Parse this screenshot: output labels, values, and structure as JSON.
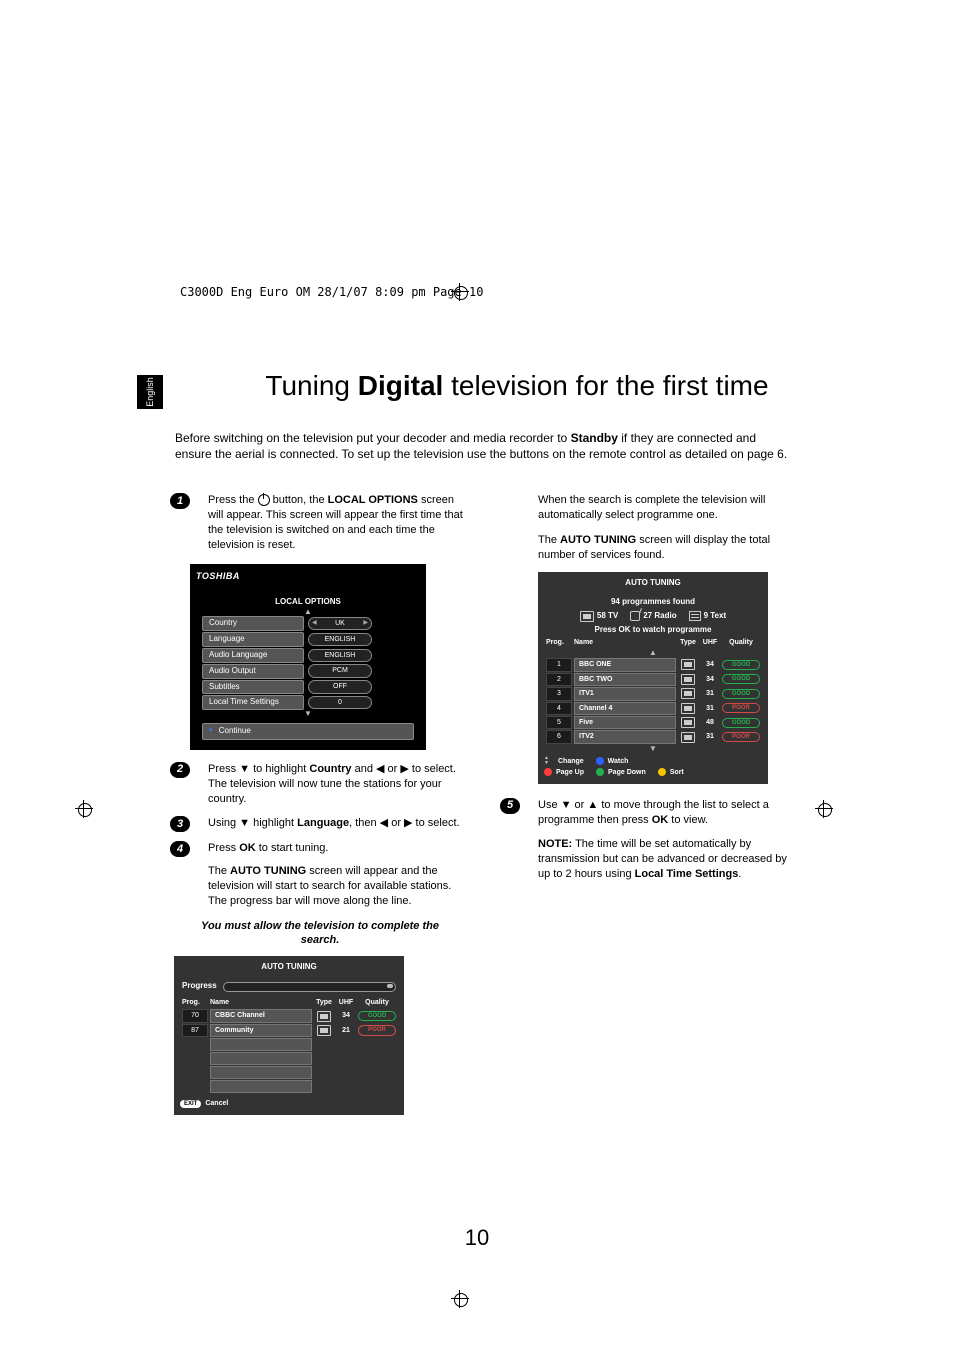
{
  "header_note": "C3000D Eng Euro OM  28/1/07  8:09 pm  Page 10",
  "sidetab": "English",
  "title_pre": "Tuning ",
  "title_bold": "Digital",
  "title_post": " television for the first time",
  "intro_a": "Before switching on the television put your decoder and media recorder to ",
  "intro_b": "Standby",
  "intro_c": " if they are connected and ensure the aerial is connected. To set up the television use the buttons on the remote control as detailed on page 6.",
  "steps": {
    "s1": {
      "num": "1",
      "pre": "Press the ",
      "mid": " button, the ",
      "b1": "LOCAL OPTIONS",
      "post": " screen will appear. This screen will appear the first time that the television is switched on and each time the television is reset."
    },
    "s2": {
      "num": "2",
      "a": "Press ▼ to highlight ",
      "b1": "Country",
      "b": " and ◀ or ▶ to select. The television will now tune the stations for your country."
    },
    "s3": {
      "num": "3",
      "a": "Using ▼ highlight ",
      "b1": "Language",
      "b": ", then ◀ or ▶ to select."
    },
    "s4": {
      "num": "4",
      "a": "Press ",
      "b1": "OK",
      "b": " to start tuning.",
      "para_a": "The ",
      "para_b": "AUTO TUNING",
      "para_c": " screen will appear and the television will start to search for available stations. The progress bar will move along the line.",
      "emph": "You must allow the television to complete the search."
    },
    "sR1": "When the search is complete the television will automatically select programme one.",
    "sR2_a": "The ",
    "sR2_b": "AUTO TUNING",
    "sR2_c": " screen will display the total number of services found.",
    "s5": {
      "num": "5",
      "a": "Use ▼ or ▲ to move through the list to select a programme then press ",
      "b1": "OK",
      "b": " to view."
    },
    "note_a": "NOTE:",
    "note_b": " The time will be set automatically by transmission but can be advanced or decreased by up to 2 hours using ",
    "note_c": "Local Time Settings",
    "note_d": "."
  },
  "local_options": {
    "brand": "TOSHIBA",
    "title": "LOCAL OPTIONS",
    "rows": [
      {
        "label": "Country",
        "value": "UK",
        "pill": true
      },
      {
        "label": "Language",
        "value": "ENGLISH"
      },
      {
        "label": "Audio Language",
        "value": "ENGLISH"
      },
      {
        "label": "Audio Output",
        "value": "PCM"
      },
      {
        "label": "Subtitles",
        "value": "OFF"
      },
      {
        "label": "Local Time Settings",
        "value": "0"
      }
    ],
    "continue": "Continue"
  },
  "auto_search": {
    "title": "AUTO TUNING",
    "progress": "Progress",
    "headers": {
      "prog": "Prog.",
      "name": "Name",
      "type": "Type",
      "uhf": "UHF",
      "quality": "Quality"
    },
    "rows": [
      {
        "prog": "70",
        "name": "CBBC Channel",
        "uhf": "34",
        "quality": "GOOD",
        "qclass": "q-good"
      },
      {
        "prog": "87",
        "name": "Community",
        "uhf": "21",
        "quality": "POOR",
        "qclass": "q-poor"
      }
    ],
    "empty_rows": 4,
    "cancel": "Cancel",
    "exit": "EXIT"
  },
  "auto_done": {
    "title": "AUTO TUNING",
    "found": "94 programmes found",
    "counts": {
      "tv": "58 TV",
      "radio": "27 Radio",
      "text": "9 Text"
    },
    "prompt": "Press OK to watch programme",
    "headers": {
      "prog": "Prog.",
      "name": "Name",
      "type": "Type",
      "uhf": "UHF",
      "quality": "Quality"
    },
    "rows": [
      {
        "prog": "1",
        "name": "BBC ONE",
        "uhf": "34",
        "quality": "GOOD",
        "qclass": "q-good"
      },
      {
        "prog": "2",
        "name": "BBC TWO",
        "uhf": "34",
        "quality": "GOOD",
        "qclass": "q-good"
      },
      {
        "prog": "3",
        "name": "ITV1",
        "uhf": "31",
        "quality": "GOOD",
        "qclass": "q-good"
      },
      {
        "prog": "4",
        "name": "Channel 4",
        "uhf": "31",
        "quality": "POOR",
        "qclass": "q-poor"
      },
      {
        "prog": "5",
        "name": "Five",
        "uhf": "48",
        "quality": "GOOD",
        "qclass": "q-good"
      },
      {
        "prog": "6",
        "name": "ITV2",
        "uhf": "31",
        "quality": "POOR",
        "qclass": "q-poor"
      }
    ],
    "legend": {
      "change": "Change",
      "watch": "Watch",
      "pageup": "Page Up",
      "pagedown": "Page Down",
      "sort": "Sort"
    }
  },
  "page_number": "10"
}
